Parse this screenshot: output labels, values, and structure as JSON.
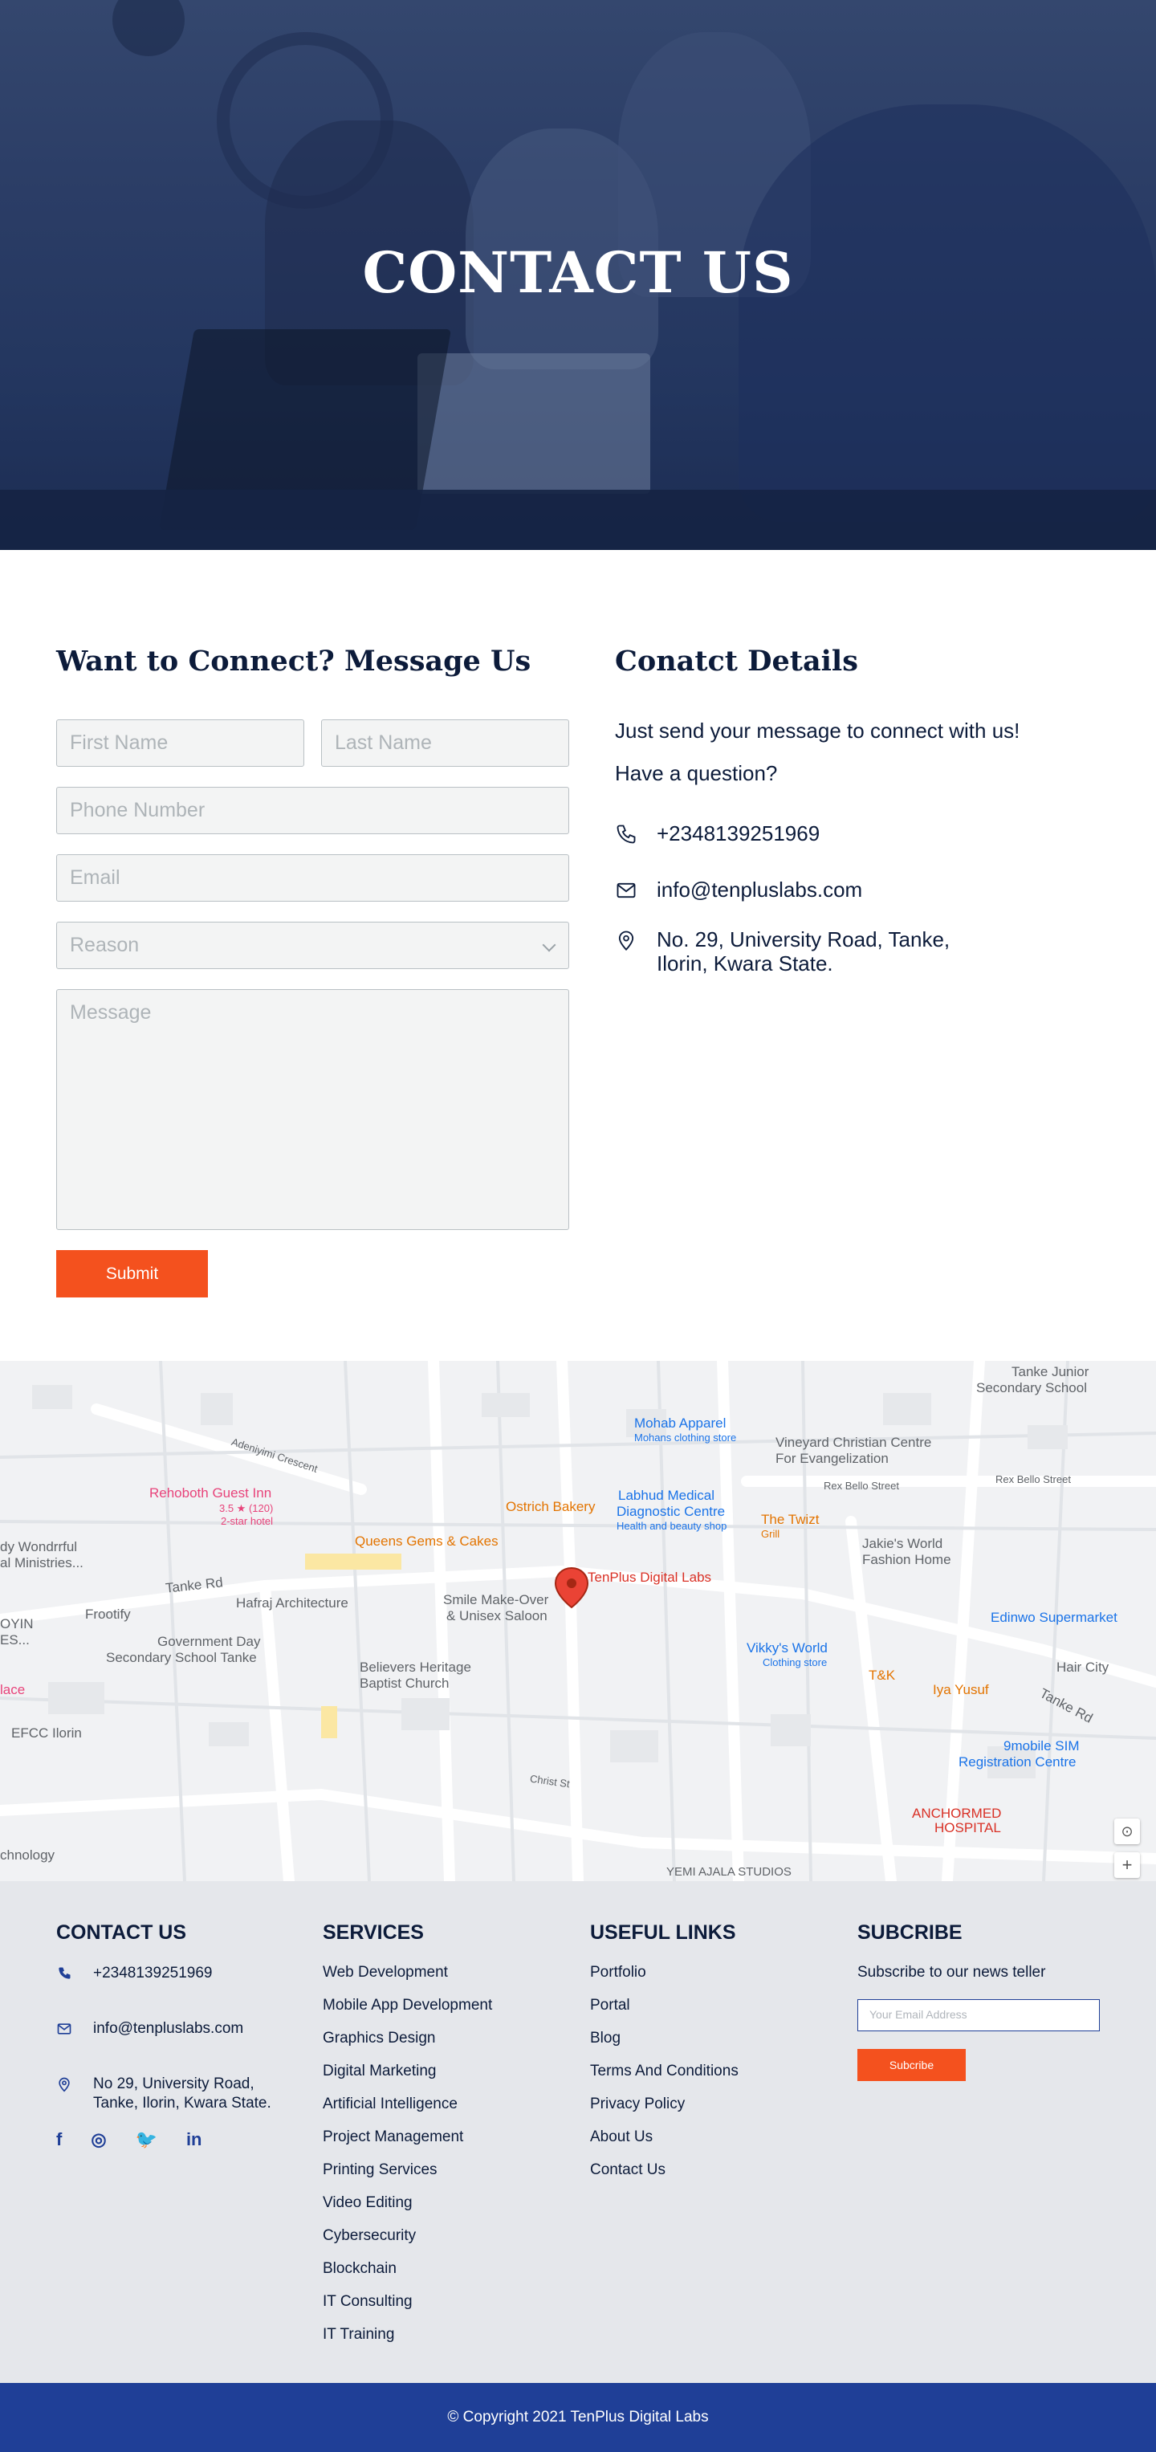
{
  "hero": {
    "title": "CONTACT US"
  },
  "form": {
    "title": "Want to Connect? Message Us",
    "first_name_placeholder": "First Name",
    "last_name_placeholder": "Last Name",
    "phone_placeholder": "Phone Number",
    "email_placeholder": "Email",
    "reason_placeholder": "Reason",
    "message_placeholder": "Message",
    "submit_label": "Submit"
  },
  "contact": {
    "title": "Conatct Details",
    "line1": "Just send your message to connect with us!",
    "line2": "Have a question?",
    "phone": "+2348139251969",
    "email": "info@tenpluslabs.com",
    "address_line1": "No. 29, University Road, Tanke,",
    "address_line2": "Ilorin, Kwara State.",
    "phone_icon": "phone-icon",
    "email_icon": "mail-icon",
    "address_icon": "location-pin-icon"
  },
  "map": {
    "labels": {
      "tenplus": "TenPlus Digital Labs",
      "rehoboth": "Rehoboth Guest Inn",
      "rehoboth_rating": "3.5 ★ (120)",
      "rehoboth_type": "2-star hotel",
      "queens": "Queens Gems & Cakes",
      "ostrich": "Ostrich Bakery",
      "labhud": "Labhud Medical",
      "labhud2": "Diagnostic Centre",
      "labhud3": "Health and beauty shop",
      "mohab": "Mohab Apparel",
      "mohab2": "Mohans clothing store",
      "vineyard": "Vineyard Christian Centre",
      "vineyard2": "For Evangelization",
      "tanke_junior": "Tanke Junior",
      "tanke_junior2": "Secondary School",
      "twizt": "The Twizt",
      "twizt2": "Grill",
      "jakie": "Jakie's World",
      "jakie2": "Fashion Home",
      "hafraj": "Hafraj Architecture",
      "smile": "Smile Make-Over",
      "smile2": "& Unisex Saloon",
      "frootify": "Frootify",
      "govday": "Government Day",
      "govday2": "Secondary School Tanke",
      "believers": "Believers Heritage",
      "believers2": "Baptist Church",
      "vikky": "Vikky's World",
      "vikky2": "Clothing store",
      "edinwo": "Edinwo Supermarket",
      "hair": "Hair City",
      "tk": "T&K",
      "iya": "Iya Yusuf",
      "ninemobile": "9mobile SIM",
      "ninemobile2": "Registration Centre",
      "anchormed": "ANCHORMED",
      "anchormed2": "HOSPITAL",
      "efcc": "EFCC Ilorin",
      "tanke_rd": "Tanke Rd",
      "tanke_rd2": "Tanke Rd",
      "rex": "Rex Bello Street",
      "rex2": "Rex Bello Street",
      "adenijimi": "Adeniyimi Crescent",
      "christ": "Christ St",
      "yemi": "YEMI AJALA STUDIOS",
      "wondrful": "dy Wondrrful",
      "ministries": "al Ministries...",
      "oyin": "OYIN",
      "ies": "ES...",
      "lace": "lace",
      "chnology": "chnology"
    },
    "zoom_in": "+"
  },
  "footer": {
    "contact_head": "CONTACT US",
    "phone": "+2348139251969",
    "email": "info@tenpluslabs.com",
    "address_line1": "No 29, University Road,",
    "address_line2": "Tanke, Ilorin, Kwara State.",
    "social": [
      {
        "label": "f",
        "icon": "facebook-icon"
      },
      {
        "label": "◎",
        "icon": "instagram-icon"
      },
      {
        "label": "🐦",
        "icon": "twitter-icon"
      },
      {
        "label": "in",
        "icon": "linkedin-icon"
      }
    ],
    "services_head": "SERVICES",
    "services": [
      "Web Development",
      "Mobile App Development",
      "Graphics Design",
      "Digital Marketing",
      "Artificial Intelligence",
      "Project Management",
      "Printing Services",
      "Video Editing",
      "Cybersecurity",
      "Blockchain",
      "IT Consulting",
      "IT Training"
    ],
    "links_head": "USEFUL LINKS",
    "links": [
      "Portfolio",
      "Portal",
      "Blog",
      "Terms And Conditions",
      "Privacy Policy",
      "About Us",
      "Contact Us"
    ],
    "subscribe_head": "SUBCRIBE",
    "subscribe_desc": "Subscribe to our news teller",
    "subscribe_placeholder": "Your Email Address",
    "subscribe_button": "Subcribe"
  },
  "copyright": "© Copyright 2021 TenPlus Digital Labs",
  "colors": {
    "accent": "#f4511e",
    "brand": "#1f3f97",
    "navy": "#0c1b3a"
  }
}
